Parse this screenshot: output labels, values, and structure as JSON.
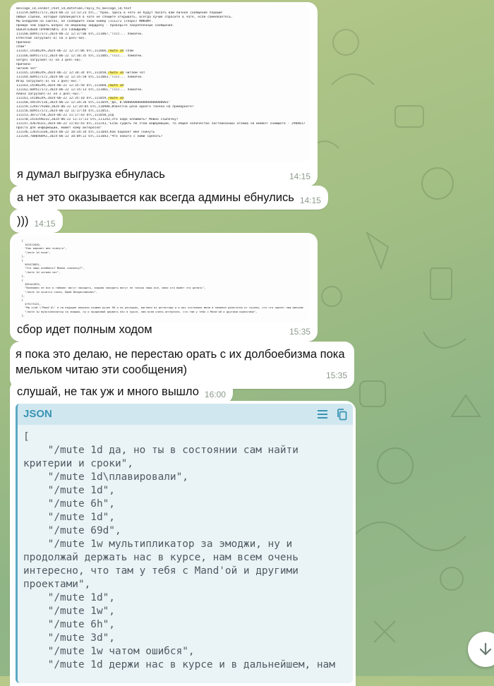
{
  "colors": {
    "bubble": "#ffffff",
    "json_header": "#d0e7ef",
    "json_accent": "#3a93b5",
    "highlight": "#fff36b",
    "time": "#8d9a8d"
  },
  "messages": {
    "m1": {
      "doc_lines": [
        "message_id,sender_chat_id,datetime,reply_to_message_id,text",
        "111159,609517172,2024-06-22 13:13:23 UTC,,\"Урой, здесь в чате не будут писать вам личное сообщение первым!",
        "Любые ссылки, которые публикуются в чате не спешите открывать, всегда лучше спросите в чате, если сомневаетесь.",
        "Мы внедряем на сайтах, не сообщайте свой номер (1112/2 (скоро) МИКОФУ.",
        "Прежде чем задать вопрос по медовому айрдропу - проверьте закрепленные сообщения.",
        "",
        "ОБЯЗАТЕЛЬНО ПРОЧИТАЙТЕ ЭТО СООБЩЕНИЕ\"",
        "111168,609517172,2024-06-22 12:37:06 UTC,111067,\"Тссс... помолчи.",
        "Ethereum загрузил(-а) на 3 дня(-ей).",
        "Причина:",
        "спам\"",
        "111167,1418624%,2024-06-22 12:37:06 UTC,111066,/mute 3d спам",
        "111166,609517172,2024-06-22 12:36:35 UTC,111065,\"Тссс... помолчи.",
        "Sergei загрузил(-а) на 3 дня(-ей).",
        "Причина:",
        "читаем чат\"",
        "111165,1418624%,2024-06-22 12:36:34 UTC,111050,/mute 3d читаем чат",
        "111164,609517172,2024-06-22 12:35:58 UTC,111063,\"Тссс... помолчи.",
        "Игор загрузил(-а) на 3 дня(-ей).\"",
        "111163,1418624%,2024-06-22 12:35:58 UTC,111060,/mute 3d",
        "111162,609517172,2024-06-22 12:35:13 UTC,111061,\"Тссс... помолчи.",
        "Алина загрузил(-а) на 3 дня(-ей).\"",
        "111161,1418624%,2024-06-22 12:35:10 UTC,111059,/mute 3d",
        "111160,585197116,2024-06-22 12:34:26 UTC,111059,\"Да, 0.00000000000000000000001\"",
        "111159,124477%360,2024-06-22 12:34:05 UTC,110988,Известна цена одного токена на премаркете?",
        "111156,609517172,2024-06-22 11:17:44 UTC,111053,",
        "111153,38717758,2024-06-22 11:17:43 UTC,111050,ухд",
        "111150,1414398232,2024-06-22 11:17:22 UTC,111243,Это надо клеймить? Можно ссылочку?",
        "111147,43670331,2024-06-22 11:01:43 UTC,111243,\"Если судить по этой информации, то общее количество застейканных атомов на момент снимшота - 29088172,75",
        "Просто для информации, может кому интересно\"",
        "111146,134353330,2024-06-22 10:34:34 UTC,111044,Как вариант мне скинуть",
        "111144,7000408%1,2024-06-22 10:09:22 UTC,111043,\"Что нового с ними сделать?"
      ],
      "text": "я думал выгрузка ебнулась",
      "time": "14:15"
    },
    "m2": {
      "text": "а нет это оказывается как всегда админы ебнулись",
      "time": "14:15"
    },
    "m3": {
      "text": ")))",
      "time": "14:15"
    },
    "m4": {
      "doc_lines": [
        "  {",
        "    101512030,",
        "    \"Как вариант мне скинуть\",",
        "    \"/mute 1d пока\",",
        "  },",
        "  {",
        "    565478831,",
        "    \"Это надо клеймить? Можно ссылочку?\",",
        "    \"/mute 1d читаем чат\",",
        "  },",
        "  {",
        "    385164933,",
        "    \"Возможно не все в тайминг могут заходить, взрыва заходить могут не только лишь все, мало кто может это делать\",",
        "    \"/mute 1d хочется сказа, Юрий Владиславович\",",
        "  },",
        "  {",
        "    479175131,",
        "    \"Мы этой \\\"Mand'd\\\" и на ведущие вопросы скажем ручек 90 и на расходах, выгнали из детекторы и а вас составили мини в номинал делегатов от группы, что что проект наш малозамых так и вкусе\",",
        "    \"/mute 1w мультипликатор за эмоджи, ну и продолжай держать нас в курсе, нам всем очень интересно, что там у тебя с Mand'ой и другими проектами\",",
        "  },"
      ],
      "text": "сбор идет полным ходом",
      "time": "15:35"
    },
    "m5": {
      "text": "я пока это делаю, не перестаю орать с их долбоебизма пока мельком читаю эти сообщения)",
      "time": "15:35"
    },
    "m6": {
      "text": "слушай, не так уж и много вышло",
      "time": "16:00"
    },
    "m7": {
      "lang": "JSON",
      "menu_icon": "menu-lines-icon",
      "copy_icon": "copy-icon",
      "code": "[\n    \"/mute 1d да, но ты в состоянии сам найти критерии и сроки\",\n    \"/mute 1d\\плавировали\",\n    \"/mute 1d\",\n    \"/mute 6h\",\n    \"/mute 1d\",\n    \"/mute 69d\",\n    \"/mute 1w мультипликатор за эмоджи, ну и продолжай держать нас в курсе, нам всем очень интересно, что там у тебя с Mand'ой и другими проектами\",\n    \"/mute 1d\",\n    \"/mute 1w\",\n    \"/mute 6h\",\n    \"/mute 3d\",\n    \"/mute 1w чатом ошибся\",\n    \"/mute 1d держи нас в курсе и в дальнейшем, нам"
    }
  },
  "scroll_button_icon": "arrow-down-icon"
}
